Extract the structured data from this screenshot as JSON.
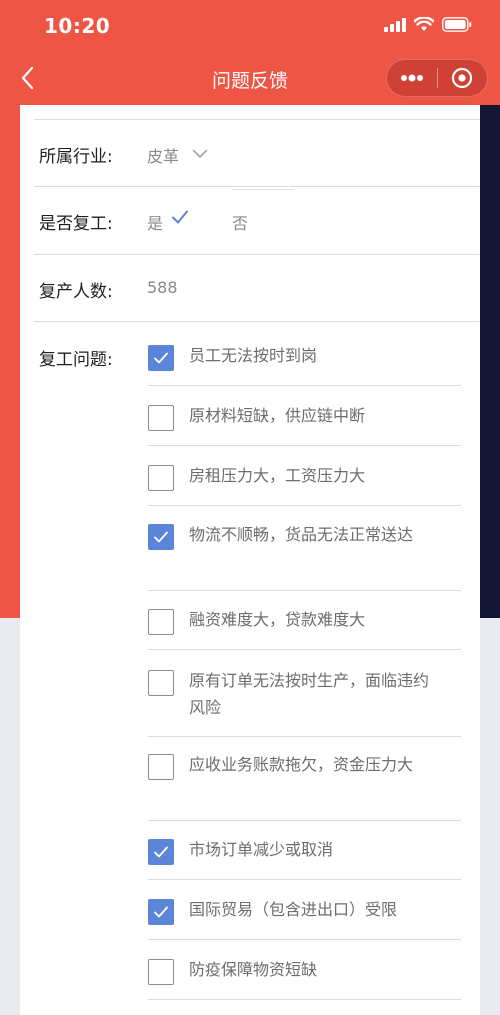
{
  "status_bar": {
    "time": "10:20"
  },
  "nav": {
    "title": "问题反馈"
  },
  "form": {
    "industry": {
      "label": "所属行业:",
      "value": "皮革"
    },
    "resumed": {
      "label": "是否复工:",
      "yes": "是",
      "no": "否",
      "selected": "是"
    },
    "headcount": {
      "label": "复产人数:",
      "value": "588"
    },
    "issues": {
      "label": "复工问题:",
      "options": [
        {
          "text": "员工无法按时到岗",
          "checked": true
        },
        {
          "text": "原材料短缺，供应链中断",
          "checked": false
        },
        {
          "text": "房租压力大，工资压力大",
          "checked": false
        },
        {
          "text": "物流不顺畅，货品无法正常送达",
          "checked": true
        },
        {
          "text": "融资难度大，贷款难度大",
          "checked": false
        },
        {
          "text": "原有订单无法按时生产，面临违约风险",
          "checked": false
        },
        {
          "text": "应收业务账款拖欠，资金压力大",
          "checked": false
        },
        {
          "text": "市场订单减少或取消",
          "checked": true
        },
        {
          "text": "国际贸易（包含进出口）受限",
          "checked": true
        },
        {
          "text": "防疫保障物资短缺",
          "checked": false
        }
      ]
    }
  },
  "colors": {
    "header_red": "#ef5545",
    "checkbox_blue": "#5b85d8",
    "side_navy": "#151634",
    "page_bg": "#e9ebf1"
  }
}
